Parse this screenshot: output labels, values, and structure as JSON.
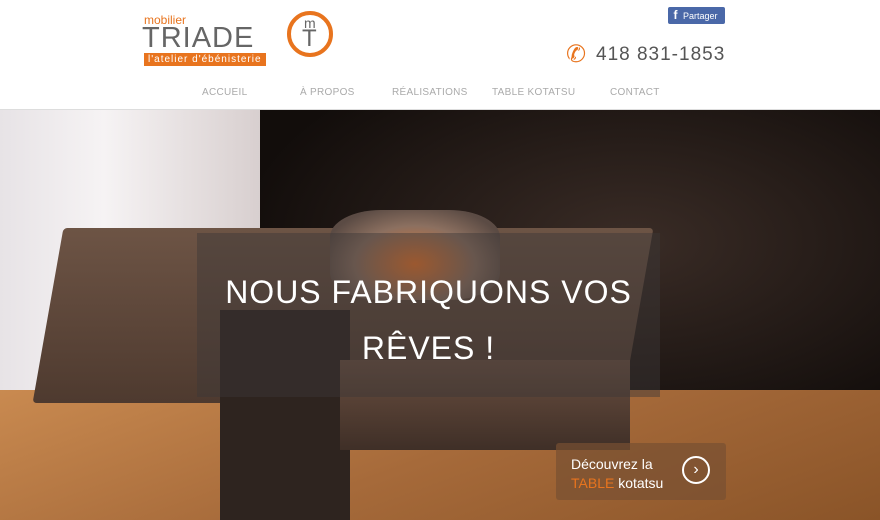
{
  "logo": {
    "top": "mobilier",
    "name": "TRIADE",
    "tagline": "l'atelier d'ébénisterie",
    "monogram_m": "m",
    "monogram_t": "T"
  },
  "share": {
    "label": "Partager",
    "icon": "facebook-icon"
  },
  "phone": {
    "icon": "phone-icon",
    "number": "418 831-1853"
  },
  "nav": {
    "items": [
      {
        "label": "ACCUEIL"
      },
      {
        "label": "À PROPOS"
      },
      {
        "label": "RÉALISATIONS"
      },
      {
        "label": "TABLE KOTATSU"
      },
      {
        "label": "CONTACT"
      }
    ]
  },
  "hero": {
    "headline_line1": "NOUS FABRIQUONS VOS",
    "headline_line2": "RÊVES !"
  },
  "cta": {
    "line1": "Découvrez la",
    "highlight": "TABLE",
    "line2_rest": " kotatsu",
    "arrow": "›"
  },
  "colors": {
    "accent": "#e8741e",
    "facebook": "#4a68a8"
  }
}
